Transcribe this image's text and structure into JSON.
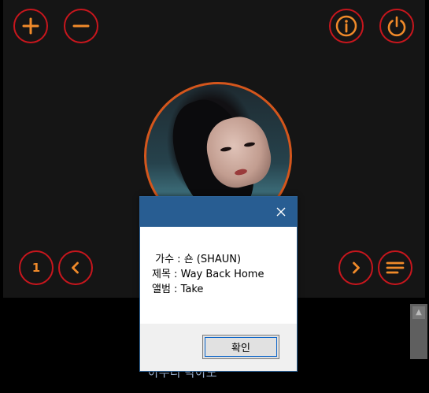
{
  "controls": {
    "top_left": [
      {
        "name": "zoom-in-button",
        "icon": "plus-icon"
      },
      {
        "name": "zoom-out-button",
        "icon": "minus-icon"
      }
    ],
    "top_right": [
      {
        "name": "info-button",
        "icon": "info-icon"
      },
      {
        "name": "power-button",
        "icon": "power-icon"
      }
    ],
    "bottom_left": {
      "track_number": "1",
      "prev_icon": "chevron-left-icon"
    },
    "bottom_right": {
      "next_icon": "chevron-right-icon",
      "playlist_icon": "menu-icon"
    }
  },
  "background_text": "아무리 막아도",
  "dialog": {
    "close_icon": "close-icon",
    "line1": " 가수 : 숀 (SHAUN)",
    "line2": "제목 : Way Back Home",
    "line3": "앨범 : Take",
    "ok_label": "확인"
  },
  "colors": {
    "button_border": "#c8161d",
    "button_icon": "#f08a2a",
    "dialog_titlebar": "#285d92"
  }
}
